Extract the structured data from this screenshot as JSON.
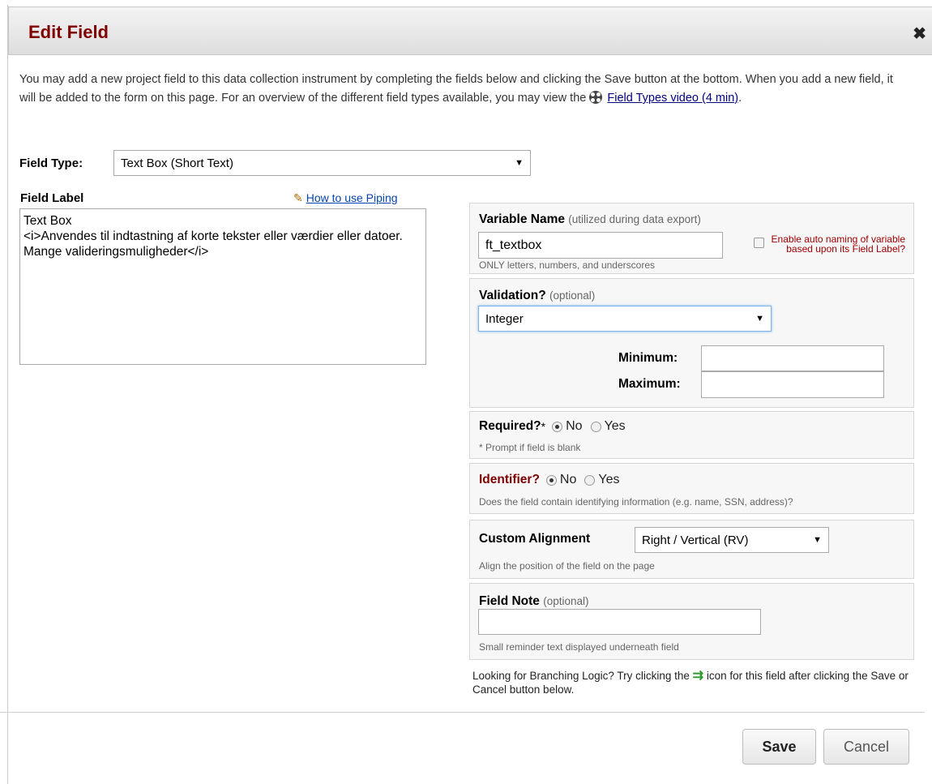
{
  "dialog": {
    "title": "Edit Field",
    "close_symbol": "✖"
  },
  "intro": {
    "text": "You may add a new project field to this data collection instrument by completing the fields below and clicking the Save button at the bottom. When you add a new field, it will be added to the form on this page. For an overview of the different field types available, you may view the ",
    "video_link": "Field Types video (4 min)",
    "end": "."
  },
  "field_type": {
    "label": "Field Type:",
    "value": "Text Box (Short Text)"
  },
  "field_label": {
    "label": "Field Label",
    "piping_link": "How to use Piping",
    "value": "Text Box\n<i>Anvendes til indtastning af korte tekster eller værdier eller datoer. Mange valideringsmuligheder</i>"
  },
  "variable_name": {
    "title": "Variable Name",
    "title_note": "(utilized during data export)",
    "value": "ft_textbox",
    "hint": "ONLY letters, numbers, and underscores",
    "auto_naming": "Enable auto naming of variable based upon its Field Label?"
  },
  "validation": {
    "title": "Validation?",
    "title_note": "(optional)",
    "value": "Integer",
    "minimum_label": "Minimum:",
    "maximum_label": "Maximum:",
    "minimum_value": "",
    "maximum_value": ""
  },
  "required": {
    "title": "Required?",
    "asterisk": "*",
    "options": [
      "No",
      "Yes"
    ],
    "selected": "No",
    "hint": "* Prompt if field is blank"
  },
  "identifier": {
    "title": "Identifier?",
    "options": [
      "No",
      "Yes"
    ],
    "selected": "No",
    "hint": "Does the field contain identifying information (e.g. name, SSN, address)?"
  },
  "alignment": {
    "title": "Custom Alignment",
    "value": "Right / Vertical (RV)",
    "hint": "Align the position of the field on the page"
  },
  "field_note": {
    "title": "Field Note",
    "title_note": "(optional)",
    "value": "",
    "hint": "Small reminder text displayed underneath field"
  },
  "branching_hint": {
    "before": "Looking for Branching Logic? Try clicking the ",
    "after": " icon for this field after clicking the Save or Cancel button below."
  },
  "buttons": {
    "save": "Save",
    "cancel": "Cancel"
  },
  "colors": {
    "title": "#800000",
    "identifier": "#800000",
    "auto_naming": "#a00000",
    "link": "#0645ad"
  }
}
